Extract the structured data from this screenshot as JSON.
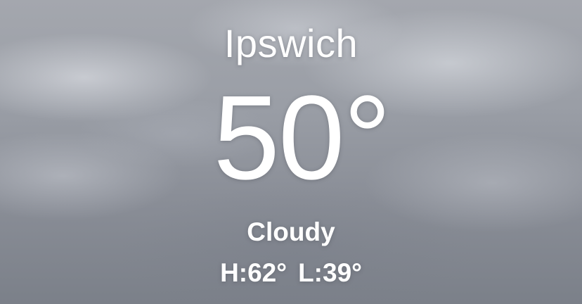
{
  "weather": {
    "city": "Ipswich",
    "temperature": "50°",
    "condition": "Cloudy",
    "high": "H:62°",
    "low": "L:39°"
  }
}
